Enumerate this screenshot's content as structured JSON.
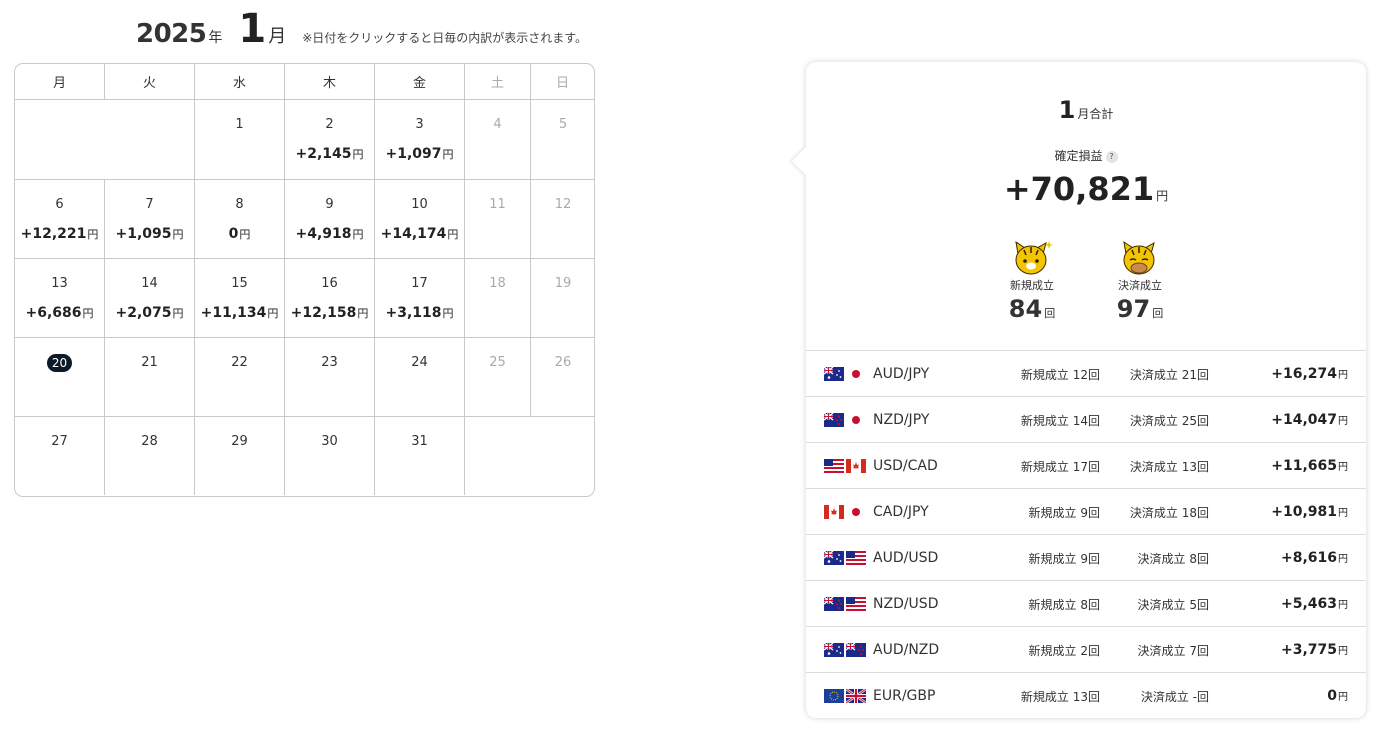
{
  "header": {
    "year": "2025",
    "year_unit": "年",
    "month": "1",
    "month_unit": "月",
    "note": "※日付をクリックすると日毎の内訳が表示されます。"
  },
  "calendar": {
    "weekdays": [
      "月",
      "火",
      "水",
      "木",
      "金",
      "土",
      "日"
    ],
    "currency_unit": "円",
    "today": "20",
    "weeks": [
      [
        {
          "day": "",
          "pl": ""
        },
        {
          "day": "",
          "pl": ""
        },
        {
          "day": "1",
          "pl": ""
        },
        {
          "day": "2",
          "pl": "+2,145"
        },
        {
          "day": "3",
          "pl": "+1,097"
        },
        {
          "day": "4",
          "pl": ""
        },
        {
          "day": "5",
          "pl": ""
        }
      ],
      [
        {
          "day": "6",
          "pl": "+12,221"
        },
        {
          "day": "7",
          "pl": "+1,095"
        },
        {
          "day": "8",
          "pl": "0"
        },
        {
          "day": "9",
          "pl": "+4,918"
        },
        {
          "day": "10",
          "pl": "+14,174"
        },
        {
          "day": "11",
          "pl": ""
        },
        {
          "day": "12",
          "pl": ""
        }
      ],
      [
        {
          "day": "13",
          "pl": "+6,686"
        },
        {
          "day": "14",
          "pl": "+2,075"
        },
        {
          "day": "15",
          "pl": "+11,134"
        },
        {
          "day": "16",
          "pl": "+12,158"
        },
        {
          "day": "17",
          "pl": "+3,118"
        },
        {
          "day": "18",
          "pl": ""
        },
        {
          "day": "19",
          "pl": ""
        }
      ],
      [
        {
          "day": "20",
          "pl": ""
        },
        {
          "day": "21",
          "pl": ""
        },
        {
          "day": "22",
          "pl": ""
        },
        {
          "day": "23",
          "pl": ""
        },
        {
          "day": "24",
          "pl": ""
        },
        {
          "day": "25",
          "pl": ""
        },
        {
          "day": "26",
          "pl": ""
        }
      ],
      [
        {
          "day": "27",
          "pl": ""
        },
        {
          "day": "28",
          "pl": ""
        },
        {
          "day": "29",
          "pl": ""
        },
        {
          "day": "30",
          "pl": ""
        },
        {
          "day": "31",
          "pl": ""
        },
        {
          "day": "",
          "pl": ""
        },
        {
          "day": "",
          "pl": ""
        }
      ]
    ]
  },
  "summary": {
    "month": "1",
    "title_suffix": "月合計",
    "pnl_label": "確定損益",
    "help_icon": "?",
    "pnl_value": "+70,821",
    "currency_unit": "円",
    "new_label": "新規成立",
    "new_count": "84",
    "close_label": "決済成立",
    "close_count": "97",
    "count_unit": "回"
  },
  "pairs": [
    {
      "flags": [
        "au",
        "jp"
      ],
      "pair": "AUD/JPY",
      "new": "新規成立 12回",
      "close": "決済成立 21回",
      "amount": "+16,274"
    },
    {
      "flags": [
        "nz",
        "jp"
      ],
      "pair": "NZD/JPY",
      "new": "新規成立 14回",
      "close": "決済成立 25回",
      "amount": "+14,047"
    },
    {
      "flags": [
        "us",
        "ca"
      ],
      "pair": "USD/CAD",
      "new": "新規成立 17回",
      "close": "決済成立 13回",
      "amount": "+11,665"
    },
    {
      "flags": [
        "ca",
        "jp"
      ],
      "pair": "CAD/JPY",
      "new": "新規成立 9回",
      "close": "決済成立 18回",
      "amount": "+10,981"
    },
    {
      "flags": [
        "au",
        "us"
      ],
      "pair": "AUD/USD",
      "new": "新規成立 9回",
      "close": "決済成立 8回",
      "amount": "+8,616"
    },
    {
      "flags": [
        "nz",
        "us"
      ],
      "pair": "NZD/USD",
      "new": "新規成立 8回",
      "close": "決済成立 5回",
      "amount": "+5,463"
    },
    {
      "flags": [
        "au",
        "nz"
      ],
      "pair": "AUD/NZD",
      "new": "新規成立 2回",
      "close": "決済成立 7回",
      "amount": "+3,775"
    },
    {
      "flags": [
        "eu",
        "gb"
      ],
      "pair": "EUR/GBP",
      "new": "新規成立 13回",
      "close": "決済成立 -回",
      "amount": "0"
    }
  ]
}
